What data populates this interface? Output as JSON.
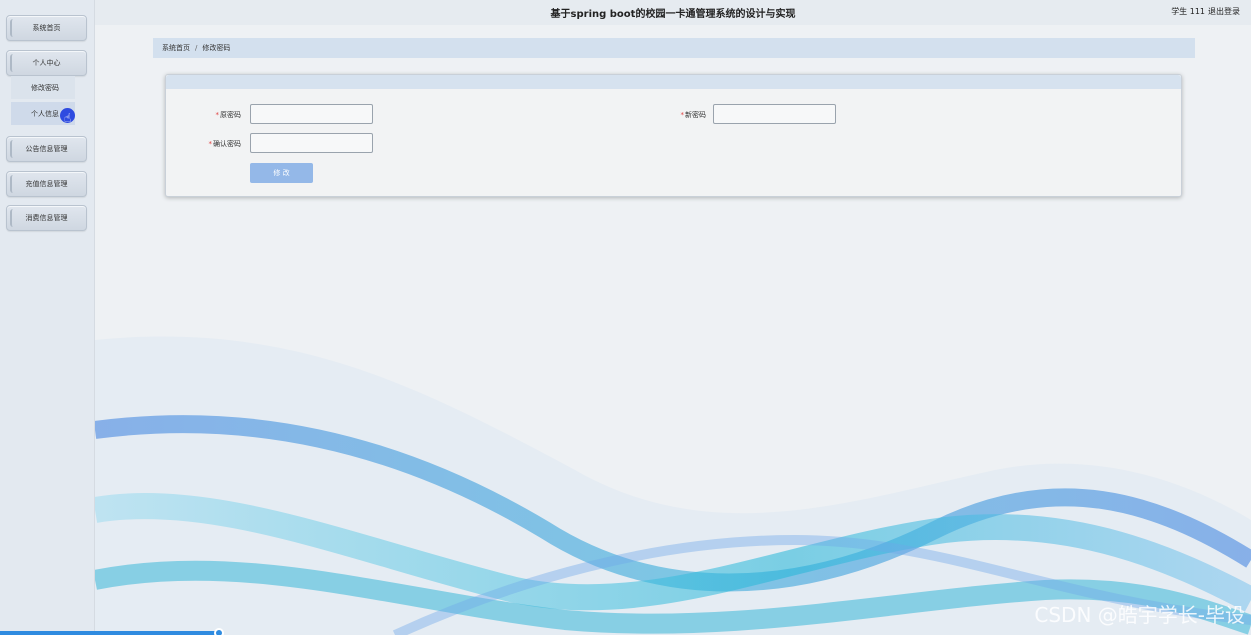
{
  "header": {
    "title": "基于spring boot的校园一卡通管理系统的设计与实现",
    "user": "学生 111",
    "logout": "退出登录"
  },
  "sidebar": {
    "items": [
      {
        "label": "系统首页"
      },
      {
        "label": "个人中心"
      },
      {
        "label": "修改密码"
      },
      {
        "label": "个人信息"
      },
      {
        "label": "公告信息管理"
      },
      {
        "label": "充值信息管理"
      },
      {
        "label": "消费信息管理"
      }
    ]
  },
  "breadcrumb": {
    "home": "系统首页",
    "separator": "/",
    "current": "修改密码"
  },
  "form": {
    "old_password_label": "原密码",
    "new_password_label": "新密码",
    "confirm_password_label": "确认密码",
    "required_mark": "*",
    "save_label": "修 改"
  },
  "video": {
    "progress_fraction": 0.175
  },
  "watermark": "CSDN @皓宇学长-毕设",
  "colors": {
    "accent": "#94b8e8",
    "breadcrumb_bg": "#d3e0ee",
    "required": "#e04040"
  }
}
